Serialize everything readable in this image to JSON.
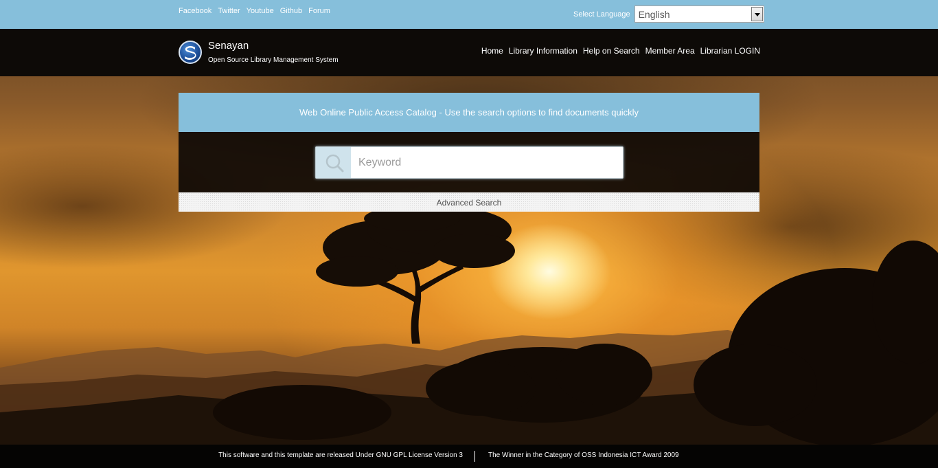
{
  "topbar": {
    "social_links": [
      "Facebook",
      "Twitter",
      "Youtube",
      "Github",
      "Forum"
    ],
    "language_label": "Select Language",
    "language_selected": "English"
  },
  "header": {
    "site_name": "Senayan",
    "site_subtitle": "Open Source Library Management System",
    "nav": [
      "Home",
      "Library Information",
      "Help on Search",
      "Member Area",
      "Librarian LOGIN"
    ]
  },
  "search": {
    "heading": "Web Online Public Access Catalog - Use the search options to find documents quickly",
    "placeholder": "Keyword",
    "value": "",
    "advanced_label": "Advanced Search"
  },
  "footer": {
    "license_text": "This software and this template are released Under GNU GPL License Version 3",
    "award_text": "The Winner in the Category of OSS Indonesia ICT Award 2009"
  },
  "colors": {
    "accent_blue": "#86bfdb",
    "header_bg": "#0d0a07",
    "footer_bg": "#050403"
  },
  "icons": {
    "search": "search-icon",
    "logo": "senayan-logo-icon",
    "dropdown": "chevron-down-icon"
  }
}
